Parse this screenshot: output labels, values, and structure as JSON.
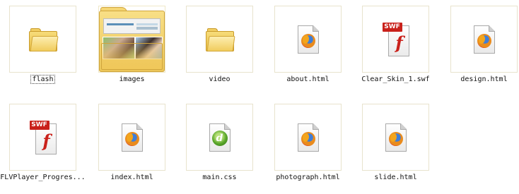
{
  "files": [
    {
      "name": "flash",
      "type": "folder",
      "icon": "folder-icon",
      "focused": true
    },
    {
      "name": "images",
      "type": "folder-thumbnail",
      "icon": "images-folder-icon"
    },
    {
      "name": "video",
      "type": "folder",
      "icon": "folder-icon"
    },
    {
      "name": "about.html",
      "type": "html",
      "icon": "firefox-html-icon"
    },
    {
      "name": "Clear_Skin_1.swf",
      "type": "swf",
      "icon": "flash-swf-icon",
      "badge": "SWF"
    },
    {
      "name": "design.html",
      "type": "html",
      "icon": "firefox-html-icon"
    },
    {
      "name": "FLVPlayer_Progres...",
      "type": "swf",
      "icon": "flash-swf-icon",
      "badge": "SWF"
    },
    {
      "name": "index.html",
      "type": "html",
      "icon": "firefox-html-icon"
    },
    {
      "name": "main.css",
      "type": "css",
      "icon": "dreamweaver-css-icon",
      "glyph": "d"
    },
    {
      "name": "photograph.html",
      "type": "html",
      "icon": "firefox-html-icon"
    },
    {
      "name": "slide.html",
      "type": "html",
      "icon": "firefox-html-icon"
    }
  ],
  "colors": {
    "swf_badge": "#c9211b",
    "tile_border": "#e8e3cd"
  }
}
